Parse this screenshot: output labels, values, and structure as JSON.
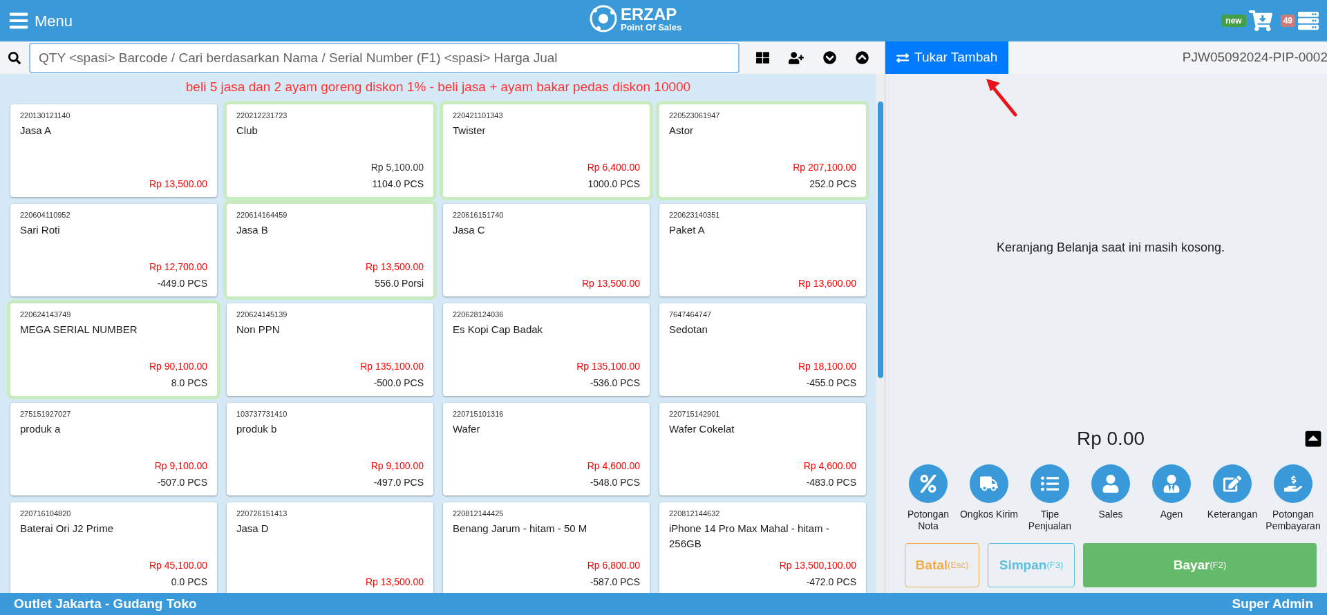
{
  "header": {
    "menu_label": "Menu",
    "logo_title": "ERZAP",
    "logo_subtitle": "Point Of Sales",
    "new_badge": "new",
    "count_badge": "49"
  },
  "search": {
    "placeholder": "QTY <spasi> Barcode / Cari berdasarkan Nama / Serial Number (F1) <spasi> Harga Jual"
  },
  "promo": "beli 5 jasa dan 2 ayam goreng diskon 1% - beli jasa + ayam bakar pedas diskon 10000",
  "products": [
    {
      "code": "220130121140",
      "name": "Jasa A",
      "price": "Rp 13,500.00",
      "alert": true,
      "highlighted": false
    },
    {
      "code": "220212231723",
      "name": "Club",
      "price": "Rp 5,100.00",
      "stock": "1104.0 PCS",
      "alert": false,
      "highlighted": true
    },
    {
      "code": "220421101343",
      "name": "Twister",
      "price": "Rp 6,400.00",
      "stock": "1000.0 PCS",
      "alert": true,
      "highlighted": true
    },
    {
      "code": "220523061947",
      "name": "Astor",
      "price": "Rp 207,100.00",
      "stock": "252.0 PCS",
      "alert": true,
      "highlighted": true
    },
    {
      "code": "220604110952",
      "name": "Sari Roti",
      "price": "Rp 12,700.00",
      "stock": "-449.0 PCS",
      "alert": true,
      "highlighted": false
    },
    {
      "code": "220614164459",
      "name": "Jasa B",
      "price": "Rp 13,500.00",
      "stock": "556.0 Porsi",
      "alert": true,
      "highlighted": true
    },
    {
      "code": "220616151740",
      "name": "Jasa C",
      "price": "Rp 13,500.00",
      "alert": true,
      "highlighted": false
    },
    {
      "code": "220623140351",
      "name": "Paket A",
      "price": "Rp 13,600.00",
      "alert": true,
      "highlighted": false
    },
    {
      "code": "220624143749",
      "name": "MEGA SERIAL NUMBER",
      "price": "Rp 90,100.00",
      "stock": "8.0 PCS",
      "alert": true,
      "highlighted": true
    },
    {
      "code": "220624145139",
      "name": "Non PPN",
      "price": "Rp 135,100.00",
      "stock": "-500.0 PCS",
      "alert": true,
      "highlighted": false
    },
    {
      "code": "220628124036",
      "name": "Es Kopi Cap Badak",
      "price": "Rp 135,100.00",
      "stock": "-536.0 PCS",
      "alert": true,
      "highlighted": false
    },
    {
      "code": "7647464747",
      "name": "Sedotan",
      "price": "Rp 18,100.00",
      "stock": "-455.0 PCS",
      "alert": true,
      "highlighted": false
    },
    {
      "code": "275151927027",
      "name": "produk a",
      "price": "Rp 9,100.00",
      "stock": "-507.0 PCS",
      "alert": true,
      "highlighted": false
    },
    {
      "code": "103737731410",
      "name": "produk b",
      "price": "Rp 9,100.00",
      "stock": "-497.0 PCS",
      "alert": true,
      "highlighted": false
    },
    {
      "code": "220715101316",
      "name": "Wafer",
      "price": "Rp 4,600.00",
      "stock": "-548.0 PCS",
      "alert": true,
      "highlighted": false
    },
    {
      "code": "220715142901",
      "name": "Wafer Cokelat",
      "price": "Rp 4,600.00",
      "stock": "-483.0 PCS",
      "alert": true,
      "highlighted": false
    },
    {
      "code": "220716104820",
      "name": "Baterai Ori J2 Prime",
      "price": "Rp 45,100.00",
      "stock": "0.0 PCS",
      "alert": true,
      "highlighted": false
    },
    {
      "code": "220726151413",
      "name": "Jasa D",
      "price": "Rp 13,500.00",
      "alert": true,
      "highlighted": false
    },
    {
      "code": "220812144425",
      "name": "Benang Jarum - hitam - 50 M",
      "price": "Rp 6,800.00",
      "stock": "-587.0 PCS",
      "alert": true,
      "highlighted": false
    },
    {
      "code": "220812144632",
      "name": "iPhone 14 Pro Max Mahal - hitam - 256GB",
      "price": "Rp 13,500,100.00",
      "stock": "-472.0 PCS",
      "alert": true,
      "highlighted": false
    }
  ],
  "cart": {
    "tab_label": "Tukar Tambah",
    "order_number": "PJW05092024-PIP-0002",
    "empty_message": "Keranjang Belanja saat ini masih kosong.",
    "total": "Rp 0.00"
  },
  "actions": [
    {
      "kind": "discount",
      "label": "Potongan Nota"
    },
    {
      "kind": "truck",
      "label": "Ongkos Kirim"
    },
    {
      "kind": "list",
      "label": "Tipe Penjualan"
    },
    {
      "kind": "person",
      "label": "Sales"
    },
    {
      "kind": "agent",
      "label": "Agen"
    },
    {
      "kind": "note",
      "label": "Keterangan"
    },
    {
      "kind": "money",
      "label": "Potongan Pembayaran"
    }
  ],
  "buttons": [
    {
      "kind": "cancel",
      "label": "Batal",
      "shortcut": "(Esc)"
    },
    {
      "kind": "save",
      "label": "Simpan",
      "shortcut": "(F3)"
    },
    {
      "kind": "pay",
      "label": "Bayar",
      "shortcut": "(F2)"
    }
  ],
  "status_bar": {
    "outlet": "Outlet Jakarta - Gudang Toko",
    "user": "Super Admin"
  }
}
